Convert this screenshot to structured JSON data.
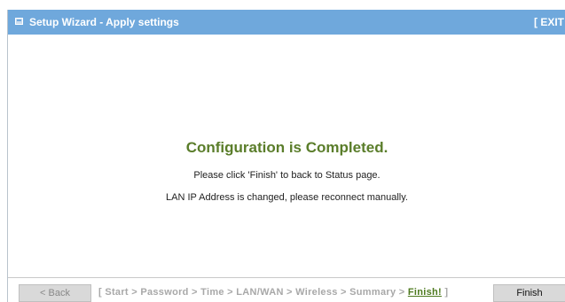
{
  "header": {
    "title": "Setup Wizard - Apply settings",
    "exit_label": "[ EXIT"
  },
  "main": {
    "headline": "Configuration is Completed.",
    "message_finish": "Please click 'Finish' to back to Status page.",
    "message_lan": "LAN IP Address is changed, please reconnect manually."
  },
  "footer": {
    "back_label": "< Back",
    "finish_label": "Finish",
    "steps_open": "[ ",
    "steps": [
      "Start",
      "Password",
      "Time",
      "LAN/WAN",
      "Wireless",
      "Summary"
    ],
    "separator": " > ",
    "current_step": "Finish!",
    "steps_close": " ]"
  },
  "colors": {
    "titlebar": "#6fa8dc",
    "headline": "#5a7d2a",
    "current_step": "#4e7a1f",
    "inactive_step": "#a8a8a8",
    "button_bg": "#d9d9d9"
  },
  "icons": {
    "title_icon": "window-icon"
  }
}
